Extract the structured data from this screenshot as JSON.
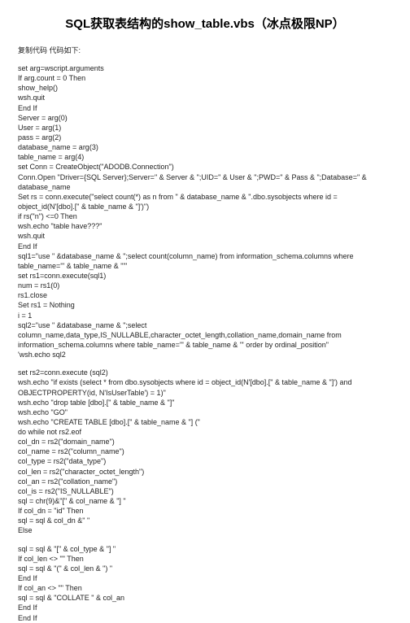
{
  "title": "SQL获取表结构的show_table.vbs（冰点极限NP）",
  "intro": "复制代码 代码如下:",
  "code_block1": "set arg=wscript.arguments\nIf arg.count = 0 Then\nshow_help()\nwsh.quit\nEnd If\nServer = arg(0)\nUser = arg(1)\npass = arg(2)\ndatabase_name = arg(3)\ntable_name = arg(4)\nset Conn = CreateObject(\"ADODB.Connection\")\nConn.Open \"Driver={SQL Server};Server=\" & Server & \";UID=\" & User & \";PWD=\" & Pass & \";Database=\" & database_name\nSet rs = conn.execute(\"select count(*) as n from \" & database_name & \".dbo.sysobjects where id = object_id(N'[dbo].[\" & table_name & \"]')\")\nif rs(\"n\") <=0 Then\nwsh.echo \"table have???\"\nwsh.quit\nEnd If\nsql1=\"use \" &database_name & \";select count(column_name) from information_schema.columns where table_name='\" & table_name & \"'\"\nset rs1=conn.execute(sql1)\nnum = rs1(0)\nrs1.close\nSet rs1 = Nothing\ni = 1\nsql2=\"use \" &database_name & \";select column_name,data_type,IS_NULLABLE,character_octet_length,collation_name,domain_name from information_schema.columns where table_name='\" & table_name & \"' order by ordinal_position\"\n'wsh.echo sql2",
  "code_block2": "set rs2=conn.execute (sql2)\nwsh.echo \"if exists (select * from dbo.sysobjects where id = object_id(N'[dbo].[\" & table_name & \"]') and OBJECTPROPERTY(id, N'IsUserTable') = 1)\"\nwsh.echo \"drop table [dbo].[\" & table_name & \"]\"\nwsh.echo \"GO\"\nwsh.echo \"CREATE TABLE [dbo].[\" & table_name & \"] (\"\ndo while not rs2.eof\ncol_dn = rs2(\"domain_name\")\ncol_name = rs2(\"column_name\")\ncol_type = rs2(\"data_type\")\ncol_len = rs2(\"character_octet_length\")\ncol_an = rs2(\"collation_name\")\ncol_is = rs2(\"IS_NULLABLE\")\nsql = chr(9)&\"[\" & col_name & \"] \"\nIf col_dn = \"id\" Then\nsql = sql & col_dn &\" \"\nElse",
  "code_block3": "sql = sql & \"[\" & col_type & \"] \"\nIf col_len <> \"\" Then\nsql = sql & \"(\" & col_len & \") \"\nEnd If\nIf col_an <> \"\" Then\nsql = sql & \"COLLATE \" & col_an\nEnd If\nEnd If"
}
